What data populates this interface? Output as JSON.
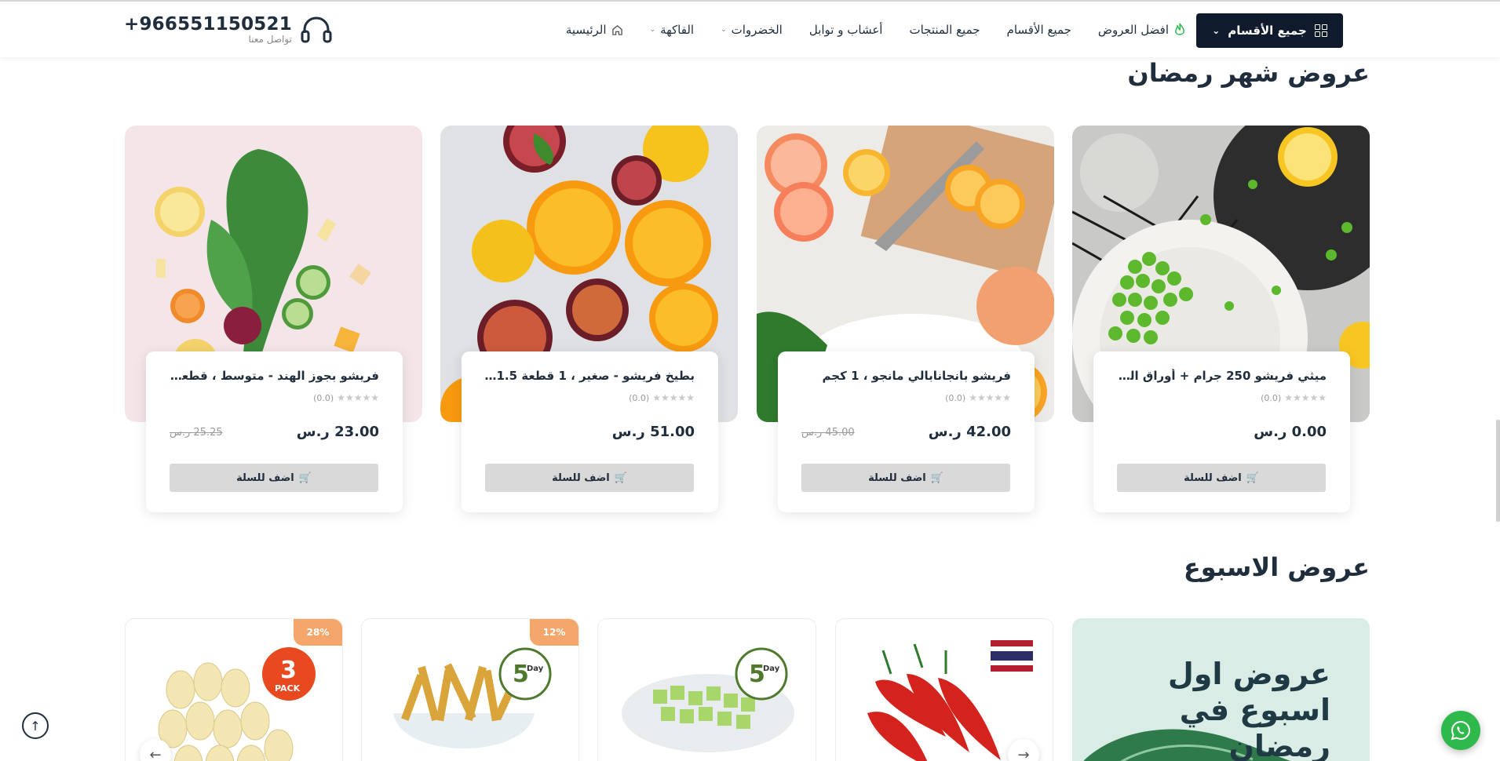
{
  "header": {
    "categories_button": "جميع الأقسام",
    "nav": [
      {
        "label": "الرئيسية",
        "icon": "home-icon",
        "dropdown": false
      },
      {
        "label": "الفاكهة",
        "dropdown": true
      },
      {
        "label": "الخضروات",
        "dropdown": true
      },
      {
        "label": "أعشاب و توابل",
        "dropdown": false
      },
      {
        "label": "جميع المنتجات",
        "dropdown": false
      },
      {
        "label": "جميع الأقسام",
        "dropdown": false
      },
      {
        "label": "افضل العروض",
        "icon": "fire-icon",
        "dropdown": false
      }
    ],
    "phone": "+966551150521",
    "contact_label": "تواصل معنا"
  },
  "ramadan": {
    "title": "عروض شهر رمضان",
    "products": [
      {
        "name": "ميثي فريشو 250 جرام + أوراق الكزبرة ...",
        "rating": "(0.0)",
        "price": "0.00 ر.س",
        "old_price": "",
        "add_label": "اضف للسلة",
        "image": "peas-bowl"
      },
      {
        "name": "فريشو بانجانابالي مانجو ، 1 كجم",
        "rating": "(0.0)",
        "price": "42.00 ر.س",
        "old_price": "45.00 ر.س",
        "add_label": "اضف للسلة",
        "image": "grapefruit-board"
      },
      {
        "name": "بطيخ فريشو - صغير ، 1 قطعة 1.5 - 2.7...",
        "rating": "(0.0)",
        "price": "51.00 ر.س",
        "old_price": "",
        "add_label": "اضف للسلة",
        "image": "citrus-slices"
      },
      {
        "name": "فريشو بجوز الهند - متوسط ، قطعة و...",
        "rating": "(0.0)",
        "price": "23.00 ر.س",
        "old_price": "25.25 ر.س",
        "add_label": "اضف للسلة",
        "image": "kale-veg"
      }
    ]
  },
  "week": {
    "title": "عروض الاسبوع",
    "promo_text": "عروض اول اسبوع في رمضان",
    "cards": [
      {
        "badge": "28%",
        "overlay": "3",
        "overlay_sub": "PACK"
      },
      {
        "badge": "12%",
        "overlay": "5",
        "overlay_sub": "Day Shelf life"
      },
      {
        "badge": "",
        "overlay": "5",
        "overlay_sub": "Day Shelf life"
      },
      {
        "badge": "",
        "overlay": "",
        "overlay_sub": ""
      }
    ]
  },
  "colors": {
    "accent": "#0f1b2d",
    "badge": "#f5a66b",
    "whatsapp": "#2fb84b",
    "promo_bg": "#d9ede6"
  }
}
